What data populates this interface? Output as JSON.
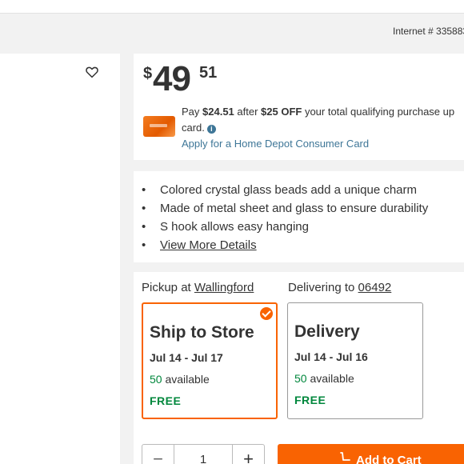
{
  "header": {
    "internet_number": "Internet # 335883"
  },
  "price": {
    "currency": "$",
    "dollars": "49",
    "cents": "51"
  },
  "promo": {
    "pay_text": "Pay ",
    "pay_amount": "$24.51",
    "after_text": " after ",
    "off_amount": "$25 OFF",
    "rest_text": " your total qualifying purchase up",
    "line2": "card.",
    "apply_link": "Apply for a Home Depot Consumer Card"
  },
  "details": {
    "bullets": [
      "Colored crystal glass beads add a unique charm",
      "Made of metal sheet and glass to ensure durability",
      "S hook allows easy hanging"
    ],
    "more_link": "View More Details"
  },
  "fulfillment": {
    "pickup_label": "Pickup at ",
    "pickup_store": "Wallingford",
    "delivering_label": "Delivering to ",
    "delivering_zip": "06492",
    "options": [
      {
        "title": "Ship to Store",
        "dates": "Jul 14 - Jul 17",
        "available_count": "50",
        "available_text": " available",
        "price": "FREE",
        "selected": true
      },
      {
        "title": "Delivery",
        "dates": "Jul 14 - Jul 16",
        "available_count": "50",
        "available_text": " available",
        "price": "FREE",
        "selected": false
      }
    ]
  },
  "cart": {
    "quantity": "1",
    "minus": "−",
    "plus": "+",
    "add_label": "Add to Cart"
  },
  "colors": {
    "brand_orange": "#f96302",
    "green": "#00873c",
    "link_blue": "#3e7697"
  },
  "icons": {
    "favorite": "heart-icon",
    "info": "info-icon",
    "selected": "check-icon",
    "cart": "cart-icon"
  }
}
